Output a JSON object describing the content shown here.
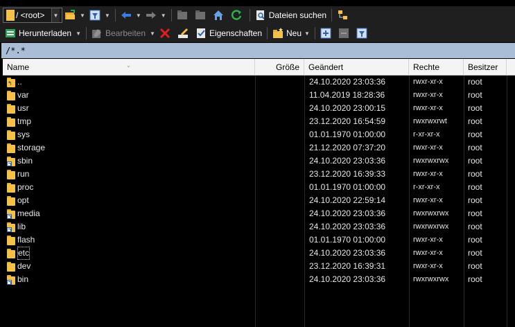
{
  "toolbar1": {
    "path_value": "/ <root>",
    "search_label": "Dateien suchen"
  },
  "toolbar2": {
    "download_label": "Herunterladen",
    "edit_label": "Bearbeiten",
    "properties_label": "Eigenschaften",
    "new_label": "Neu"
  },
  "filter": {
    "mask": "/*.*"
  },
  "columns": {
    "name": "Name",
    "size": "Größe",
    "changed": "Geändert",
    "rights": "Rechte",
    "owner": "Besitzer"
  },
  "rows": [
    {
      "name": "..",
      "date": "24.10.2020 23:03:36",
      "rights": "rwxr-xr-x",
      "owner": "root",
      "icon": "parent-folder-icon"
    },
    {
      "name": "var",
      "date": "11.04.2019 18:28:36",
      "rights": "rwxr-xr-x",
      "owner": "root",
      "icon": "folder-icon"
    },
    {
      "name": "usr",
      "date": "24.10.2020 23:00:15",
      "rights": "rwxr-xr-x",
      "owner": "root",
      "icon": "folder-icon"
    },
    {
      "name": "tmp",
      "date": "23.12.2020 16:54:59",
      "rights": "rwxrwxrwt",
      "owner": "root",
      "icon": "folder-icon"
    },
    {
      "name": "sys",
      "date": "01.01.1970 01:00:00",
      "rights": "r-xr-xr-x",
      "owner": "root",
      "icon": "folder-icon"
    },
    {
      "name": "storage",
      "date": "21.12.2020 07:37:20",
      "rights": "rwxr-xr-x",
      "owner": "root",
      "icon": "folder-icon"
    },
    {
      "name": "sbin",
      "date": "24.10.2020 23:03:36",
      "rights": "rwxrwxrwx",
      "owner": "root",
      "icon": "folder-link-icon"
    },
    {
      "name": "run",
      "date": "23.12.2020 16:39:33",
      "rights": "rwxr-xr-x",
      "owner": "root",
      "icon": "folder-icon"
    },
    {
      "name": "proc",
      "date": "01.01.1970 01:00:00",
      "rights": "r-xr-xr-x",
      "owner": "root",
      "icon": "folder-icon"
    },
    {
      "name": "opt",
      "date": "24.10.2020 22:59:14",
      "rights": "rwxr-xr-x",
      "owner": "root",
      "icon": "folder-icon"
    },
    {
      "name": "media",
      "date": "24.10.2020 23:03:36",
      "rights": "rwxrwxrwx",
      "owner": "root",
      "icon": "folder-link-icon"
    },
    {
      "name": "lib",
      "date": "24.10.2020 23:03:36",
      "rights": "rwxrwxrwx",
      "owner": "root",
      "icon": "folder-link-icon"
    },
    {
      "name": "flash",
      "date": "01.01.1970 01:00:00",
      "rights": "rwxr-xr-x",
      "owner": "root",
      "icon": "folder-icon"
    },
    {
      "name": "etc",
      "date": "24.10.2020 23:03:36",
      "rights": "rwxr-xr-x",
      "owner": "root",
      "icon": "folder-icon",
      "focused": true
    },
    {
      "name": "dev",
      "date": "23.12.2020 16:39:31",
      "rights": "rwxr-xr-x",
      "owner": "root",
      "icon": "folder-icon"
    },
    {
      "name": "bin",
      "date": "24.10.2020 23:03:36",
      "rights": "rwxrwxrwx",
      "owner": "root",
      "icon": "folder-link-icon"
    }
  ],
  "colors": {
    "toolbar_bg": "#1f1f1f",
    "filter_bg": "#a9bdd6",
    "header_bg": "#f4f4f4",
    "list_bg": "#000000",
    "folder": "#f3c04b"
  }
}
